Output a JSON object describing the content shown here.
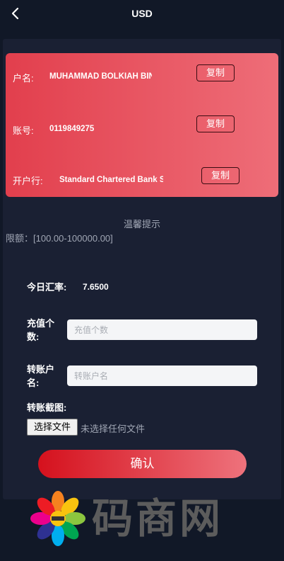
{
  "header": {
    "title": "USD"
  },
  "bank_card": {
    "rows": [
      {
        "label": "户名:",
        "value": "MUHAMMAD BOLKIAH BIN",
        "copy_label": "复制"
      },
      {
        "label": "账号:",
        "value": "0119849275",
        "copy_label": "复制"
      },
      {
        "label": "开户行:",
        "value": "Standard Chartered Bank S",
        "copy_label": "复制"
      }
    ]
  },
  "tips": {
    "title": "温馨提示",
    "limit": "限额：[100.00-100000.00]"
  },
  "form": {
    "rate_label": "今日汇率:",
    "rate_value": "7.6500",
    "amount_label_line1": "充值个",
    "amount_label_line2": "数:",
    "amount_placeholder": "充值个数",
    "account_name_label_line1": "转账户",
    "account_name_label_line2": "名:",
    "account_name_placeholder": "转账户名",
    "screenshot_label": "转账截图:",
    "file_button": "选择文件",
    "file_status": "未选择任何文件",
    "submit": "确认"
  },
  "watermark": {
    "text": "码商网"
  }
}
